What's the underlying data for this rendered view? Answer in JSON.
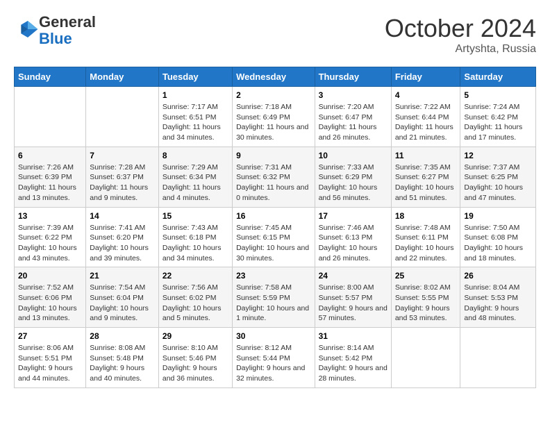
{
  "logo": {
    "general": "General",
    "blue": "Blue"
  },
  "header": {
    "month": "October 2024",
    "location": "Artyshta, Russia"
  },
  "days_of_week": [
    "Sunday",
    "Monday",
    "Tuesday",
    "Wednesday",
    "Thursday",
    "Friday",
    "Saturday"
  ],
  "weeks": [
    [
      {
        "day": "",
        "sunrise": "",
        "sunset": "",
        "daylight": ""
      },
      {
        "day": "",
        "sunrise": "",
        "sunset": "",
        "daylight": ""
      },
      {
        "day": "1",
        "sunrise": "Sunrise: 7:17 AM",
        "sunset": "Sunset: 6:51 PM",
        "daylight": "Daylight: 11 hours and 34 minutes."
      },
      {
        "day": "2",
        "sunrise": "Sunrise: 7:18 AM",
        "sunset": "Sunset: 6:49 PM",
        "daylight": "Daylight: 11 hours and 30 minutes."
      },
      {
        "day": "3",
        "sunrise": "Sunrise: 7:20 AM",
        "sunset": "Sunset: 6:47 PM",
        "daylight": "Daylight: 11 hours and 26 minutes."
      },
      {
        "day": "4",
        "sunrise": "Sunrise: 7:22 AM",
        "sunset": "Sunset: 6:44 PM",
        "daylight": "Daylight: 11 hours and 21 minutes."
      },
      {
        "day": "5",
        "sunrise": "Sunrise: 7:24 AM",
        "sunset": "Sunset: 6:42 PM",
        "daylight": "Daylight: 11 hours and 17 minutes."
      }
    ],
    [
      {
        "day": "6",
        "sunrise": "Sunrise: 7:26 AM",
        "sunset": "Sunset: 6:39 PM",
        "daylight": "Daylight: 11 hours and 13 minutes."
      },
      {
        "day": "7",
        "sunrise": "Sunrise: 7:28 AM",
        "sunset": "Sunset: 6:37 PM",
        "daylight": "Daylight: 11 hours and 9 minutes."
      },
      {
        "day": "8",
        "sunrise": "Sunrise: 7:29 AM",
        "sunset": "Sunset: 6:34 PM",
        "daylight": "Daylight: 11 hours and 4 minutes."
      },
      {
        "day": "9",
        "sunrise": "Sunrise: 7:31 AM",
        "sunset": "Sunset: 6:32 PM",
        "daylight": "Daylight: 11 hours and 0 minutes."
      },
      {
        "day": "10",
        "sunrise": "Sunrise: 7:33 AM",
        "sunset": "Sunset: 6:29 PM",
        "daylight": "Daylight: 10 hours and 56 minutes."
      },
      {
        "day": "11",
        "sunrise": "Sunrise: 7:35 AM",
        "sunset": "Sunset: 6:27 PM",
        "daylight": "Daylight: 10 hours and 51 minutes."
      },
      {
        "day": "12",
        "sunrise": "Sunrise: 7:37 AM",
        "sunset": "Sunset: 6:25 PM",
        "daylight": "Daylight: 10 hours and 47 minutes."
      }
    ],
    [
      {
        "day": "13",
        "sunrise": "Sunrise: 7:39 AM",
        "sunset": "Sunset: 6:22 PM",
        "daylight": "Daylight: 10 hours and 43 minutes."
      },
      {
        "day": "14",
        "sunrise": "Sunrise: 7:41 AM",
        "sunset": "Sunset: 6:20 PM",
        "daylight": "Daylight: 10 hours and 39 minutes."
      },
      {
        "day": "15",
        "sunrise": "Sunrise: 7:43 AM",
        "sunset": "Sunset: 6:18 PM",
        "daylight": "Daylight: 10 hours and 34 minutes."
      },
      {
        "day": "16",
        "sunrise": "Sunrise: 7:45 AM",
        "sunset": "Sunset: 6:15 PM",
        "daylight": "Daylight: 10 hours and 30 minutes."
      },
      {
        "day": "17",
        "sunrise": "Sunrise: 7:46 AM",
        "sunset": "Sunset: 6:13 PM",
        "daylight": "Daylight: 10 hours and 26 minutes."
      },
      {
        "day": "18",
        "sunrise": "Sunrise: 7:48 AM",
        "sunset": "Sunset: 6:11 PM",
        "daylight": "Daylight: 10 hours and 22 minutes."
      },
      {
        "day": "19",
        "sunrise": "Sunrise: 7:50 AM",
        "sunset": "Sunset: 6:08 PM",
        "daylight": "Daylight: 10 hours and 18 minutes."
      }
    ],
    [
      {
        "day": "20",
        "sunrise": "Sunrise: 7:52 AM",
        "sunset": "Sunset: 6:06 PM",
        "daylight": "Daylight: 10 hours and 13 minutes."
      },
      {
        "day": "21",
        "sunrise": "Sunrise: 7:54 AM",
        "sunset": "Sunset: 6:04 PM",
        "daylight": "Daylight: 10 hours and 9 minutes."
      },
      {
        "day": "22",
        "sunrise": "Sunrise: 7:56 AM",
        "sunset": "Sunset: 6:02 PM",
        "daylight": "Daylight: 10 hours and 5 minutes."
      },
      {
        "day": "23",
        "sunrise": "Sunrise: 7:58 AM",
        "sunset": "Sunset: 5:59 PM",
        "daylight": "Daylight: 10 hours and 1 minute."
      },
      {
        "day": "24",
        "sunrise": "Sunrise: 8:00 AM",
        "sunset": "Sunset: 5:57 PM",
        "daylight": "Daylight: 9 hours and 57 minutes."
      },
      {
        "day": "25",
        "sunrise": "Sunrise: 8:02 AM",
        "sunset": "Sunset: 5:55 PM",
        "daylight": "Daylight: 9 hours and 53 minutes."
      },
      {
        "day": "26",
        "sunrise": "Sunrise: 8:04 AM",
        "sunset": "Sunset: 5:53 PM",
        "daylight": "Daylight: 9 hours and 48 minutes."
      }
    ],
    [
      {
        "day": "27",
        "sunrise": "Sunrise: 8:06 AM",
        "sunset": "Sunset: 5:51 PM",
        "daylight": "Daylight: 9 hours and 44 minutes."
      },
      {
        "day": "28",
        "sunrise": "Sunrise: 8:08 AM",
        "sunset": "Sunset: 5:48 PM",
        "daylight": "Daylight: 9 hours and 40 minutes."
      },
      {
        "day": "29",
        "sunrise": "Sunrise: 8:10 AM",
        "sunset": "Sunset: 5:46 PM",
        "daylight": "Daylight: 9 hours and 36 minutes."
      },
      {
        "day": "30",
        "sunrise": "Sunrise: 8:12 AM",
        "sunset": "Sunset: 5:44 PM",
        "daylight": "Daylight: 9 hours and 32 minutes."
      },
      {
        "day": "31",
        "sunrise": "Sunrise: 8:14 AM",
        "sunset": "Sunset: 5:42 PM",
        "daylight": "Daylight: 9 hours and 28 minutes."
      },
      {
        "day": "",
        "sunrise": "",
        "sunset": "",
        "daylight": ""
      },
      {
        "day": "",
        "sunrise": "",
        "sunset": "",
        "daylight": ""
      }
    ]
  ]
}
